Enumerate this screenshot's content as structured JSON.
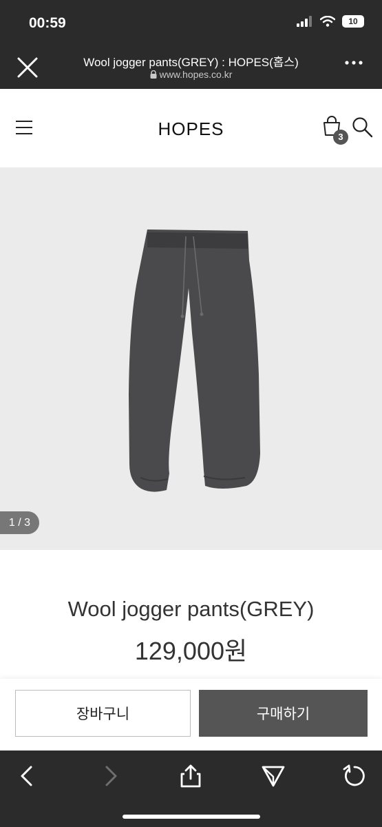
{
  "status_bar": {
    "time": "00:59",
    "battery": "10"
  },
  "browser": {
    "page_title": "Wool jogger pants(GREY) : HOPES(홉스)",
    "domain": "www.hopes.co.kr"
  },
  "header": {
    "logo": "HOPES",
    "cart_count": "3"
  },
  "gallery": {
    "indicator": "1 / 3",
    "product_color": "#4a4a4c"
  },
  "product": {
    "name": "Wool jogger pants(GREY)",
    "price": "129,000원"
  },
  "actions": {
    "cart_label": "장바구니",
    "buy_label": "구매하기"
  },
  "colors": {
    "chrome": "#2b2b2b",
    "buy_button": "#555555",
    "gallery_bg": "#ebebeb"
  }
}
